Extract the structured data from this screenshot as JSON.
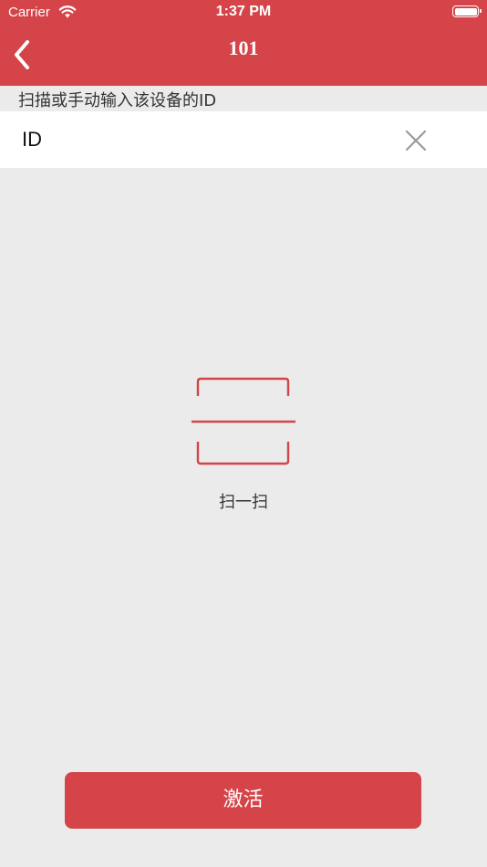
{
  "status_bar": {
    "carrier": "Carrier",
    "time": "1:37 PM"
  },
  "nav": {
    "title": "101",
    "back_icon": "chevron-left-icon"
  },
  "form": {
    "hint": "扫描或手动输入该设备的ID",
    "input_placeholder": "ID",
    "input_value": "",
    "clear_icon": "close-icon"
  },
  "scan": {
    "icon": "scan-frame-icon",
    "label": "扫一扫"
  },
  "actions": {
    "activate_label": "激活"
  },
  "colors": {
    "primary": "#d44448",
    "background": "#ebebeb"
  }
}
